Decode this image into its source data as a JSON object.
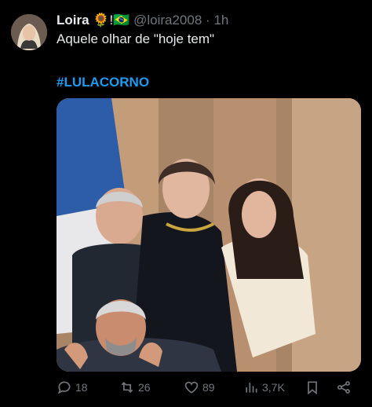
{
  "tweet": {
    "author_name": "Loira",
    "author_emojis": "🌻!🇧🇷",
    "handle": "@loira2008",
    "separator": "·",
    "time": "1h",
    "text": "Aquele olhar de \"hoje tem\"",
    "hashtag": "#LULACORNO"
  },
  "actions": {
    "replies": "18",
    "retweets": "26",
    "likes": "89",
    "views": "3,7K"
  },
  "icons": [
    "reply-icon",
    "retweet-icon",
    "like-icon",
    "views-icon",
    "bookmark-icon",
    "share-icon"
  ],
  "colors": {
    "background": "#000000",
    "text": "#e7e9ea",
    "muted": "#71767b",
    "link": "#1d9bf0"
  }
}
